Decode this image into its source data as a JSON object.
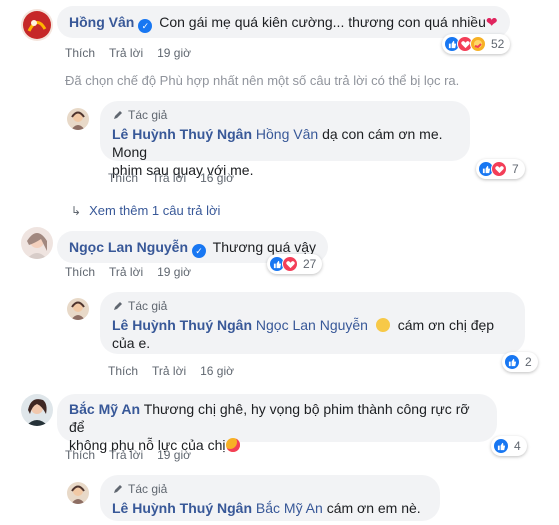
{
  "common": {
    "like_label": "Thích",
    "reply_label": "Trả lời",
    "author_badge": "Tác giả"
  },
  "comments": [
    {
      "author": "Hồng Vân",
      "text": "Con gái mẹ quá kiên cường... thương con quá nhiều",
      "time": "19 giờ",
      "reaction_count": "52",
      "reactions": [
        "like-icon",
        "love-icon",
        "care-icon"
      ]
    },
    {
      "author": "Ngọc Lan Nguyễn",
      "text": "Thương quá vậy",
      "time": "19 giờ",
      "reaction_count": "27",
      "reactions": [
        "like-icon",
        "love-icon"
      ]
    },
    {
      "author": "Bắc Mỹ An",
      "text_line1": "Thương chị ghê, hy vọng bộ phim thành công rực rỡ để",
      "text_line2": "không phụ nỗ lực của chị",
      "time": "19 giờ",
      "reaction_count": "4",
      "reactions": [
        "like-icon"
      ]
    }
  ],
  "filter_notice": "Đã chọn chế độ Phù hợp nhất nên một số câu trả lời có thể bị lọc ra.",
  "replies": [
    {
      "author": "Lê Huỳnh Thuý Ngân",
      "mention": "Hồng Vân",
      "text_line1": "dạ con cám ơn me. Mong",
      "text_line2": "phim sau quay với me.",
      "time": "16 giờ",
      "reaction_count": "7",
      "reactions": [
        "like-icon",
        "love-icon"
      ]
    },
    {
      "author": "Lê Huỳnh Thuý Ngân",
      "mention": "Ngọc Lan Nguyễn",
      "text_line1": "cám ơn chị đẹp",
      "text_line2": "của e.",
      "time": "16 giờ",
      "reaction_count": "2",
      "reactions": [
        "like-icon"
      ]
    },
    {
      "author": "Lê Huỳnh Thuý Ngân",
      "mention": "Bắc Mỹ An",
      "text_line1": "cám ơn em nè.",
      "reactions": []
    }
  ],
  "see_more": "Xem thêm 1 câu trả lời",
  "colors": {
    "link": "#385898",
    "bubble": "#f2f3f5",
    "like": "#1877f2",
    "love": "#f33e58",
    "care": "#f7b125"
  }
}
